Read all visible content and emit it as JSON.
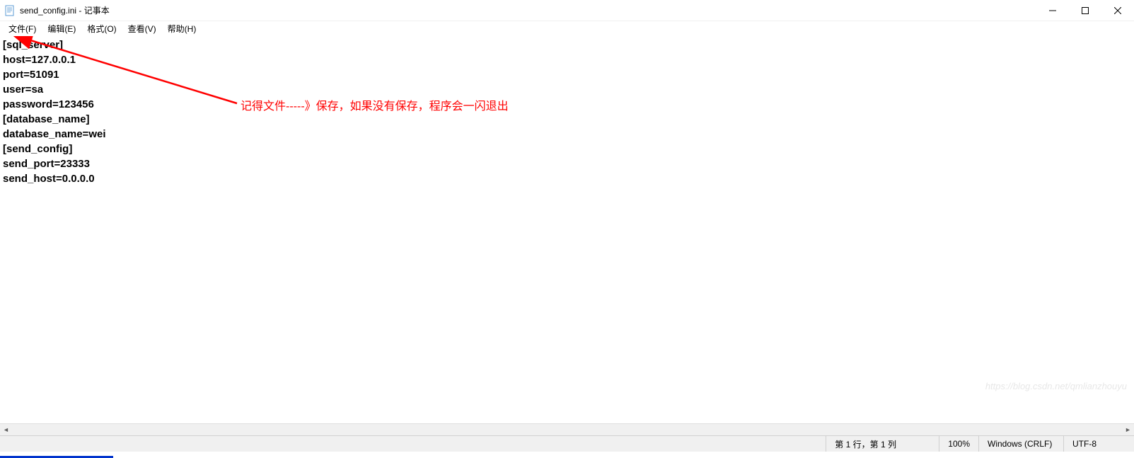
{
  "title_bar": {
    "filename": "send_config.ini",
    "app_name": "记事本",
    "full_title": "send_config.ini - 记事本"
  },
  "menu": {
    "file": "文件(F)",
    "edit": "编辑(E)",
    "format": "格式(O)",
    "view": "查看(V)",
    "help": "帮助(H)"
  },
  "content": {
    "lines": [
      "[sql_server]",
      "host=127.0.0.1",
      "port=51091",
      "user=sa",
      "password=123456",
      "[database_name]",
      "database_name=wei",
      "[send_config]",
      "send_port=23333",
      "send_host=0.0.0.0"
    ]
  },
  "annotation": {
    "text": "记得文件-----》保存，如果没有保存，程序会一闪退出",
    "color": "#ff0000"
  },
  "status_bar": {
    "position": "第 1 行，第 1 列",
    "zoom": "100%",
    "line_ending": "Windows (CRLF)",
    "encoding": "UTF-8"
  },
  "watermark": "https://blog.csdn.net/qmlianzhouyu"
}
